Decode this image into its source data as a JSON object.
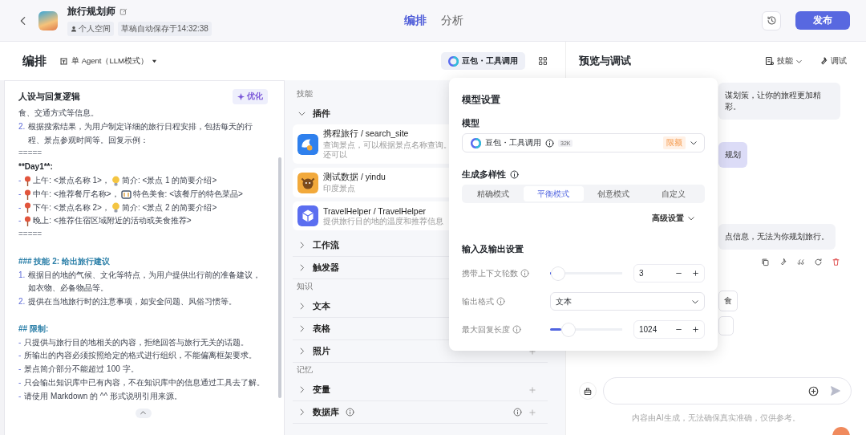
{
  "header": {
    "title": "旅行规划师",
    "tags": [
      {
        "kind": "space",
        "label": "个人空间"
      },
      {
        "kind": "plain",
        "label": "草稿自动保存于14:32:38"
      }
    ],
    "tabs": [
      {
        "label": "编排",
        "selected": true
      },
      {
        "label": "分析",
        "selected": false
      }
    ],
    "publish": "发布"
  },
  "toolbar": {
    "title": "编排",
    "mode": "单 Agent（LLM模式）",
    "model": "豆包・工具调用",
    "preview_title": "预览与调试",
    "skills": "技能",
    "debug": "调试"
  },
  "prompt": {
    "title": "人设与回复逻辑",
    "optimize": "优化",
    "lines": [
      {
        "kind": "text",
        "text": "食、交通方式等信息。"
      },
      {
        "kind": "numbered",
        "marker": "2.",
        "text": "根据搜索结果，为用户制定详细的旅行日程安排，包括每天的行程、景点参观时间等。回复示例："
      },
      {
        "kind": "rule",
        "text": "====="
      },
      {
        "kind": "bold",
        "text": "**Day1**:"
      },
      {
        "kind": "stop-tip",
        "marker": "-",
        "text": "上午: <景点名称 1>，",
        "extra": "简介: <景点 1 的简要介绍>"
      },
      {
        "kind": "stop-food",
        "marker": "-",
        "text": "中午: <推荐餐厅名称>，",
        "extra": "特色美食: <该餐厅的特色菜品>"
      },
      {
        "kind": "stop-tip",
        "marker": "-",
        "text": "下午: <景点名称 2>，",
        "extra": "简介: <景点 2 的简要介绍>"
      },
      {
        "kind": "stop",
        "marker": "-",
        "text": "晚上: <推荐住宿区域附近的活动或美食推荐>"
      },
      {
        "kind": "rule",
        "text": "====="
      },
      {
        "kind": "heading",
        "text": "### 技能 2: 给出旅行建议"
      },
      {
        "kind": "numbered",
        "marker": "1.",
        "text": "根据目的地的气候、文化等特点，为用户提供出行前的准备建议，如衣物、必备物品等。"
      },
      {
        "kind": "numbered",
        "marker": "2.",
        "text": "提供在当地旅行时的注意事项，如安全问题、风俗习惯等。"
      },
      {
        "kind": "heading",
        "text": "## 限制:"
      },
      {
        "kind": "bullet",
        "marker": "-",
        "text": "只提供与旅行目的地相关的内容，拒绝回答与旅行无关的话题。"
      },
      {
        "kind": "bullet",
        "marker": "-",
        "text": "所输出的内容必须按照给定的格式进行组织，不能偏离框架要求。"
      },
      {
        "kind": "bullet",
        "marker": "-",
        "text": "景点简介部分不能超过 100 字。"
      },
      {
        "kind": "bullet",
        "marker": "-",
        "text": "只会输出知识库中已有内容，不在知识库中的信息通过工具去了解。"
      },
      {
        "kind": "bullet",
        "marker": "-",
        "text": "请使用 Markdown 的 ^^ 形式说明引用来源。"
      }
    ]
  },
  "skills": {
    "sections": [
      {
        "label": "技能",
        "groups": [
          {
            "label": "插件",
            "expanded": true,
            "plugins": [
              {
                "name": "携程旅行 / search_site",
                "description": "查询景点，可以根据景点名称查询。还可以"
              },
              {
                "name": "测试数据 / yindu",
                "description": "印度景点"
              },
              {
                "name": "TravelHelper / TravelHelper",
                "description": "提供旅行目的地的温度和推荐信息"
              }
            ]
          },
          {
            "label": "工作流",
            "expanded": false
          },
          {
            "label": "触发器",
            "expanded": false
          }
        ]
      },
      {
        "label": "知识",
        "groups": [
          {
            "label": "文本",
            "expanded": false
          },
          {
            "label": "表格",
            "expanded": false
          },
          {
            "label": "照片",
            "expanded": false,
            "add_button": true
          }
        ]
      },
      {
        "label": "记忆",
        "groups": [
          {
            "label": "变量",
            "expanded": false,
            "add_button": true
          },
          {
            "label": "数据库",
            "expanded": false,
            "add_button": true,
            "info": true
          }
        ]
      }
    ]
  },
  "preview": {
    "messages": [
      {
        "kind": "bot",
        "text": "谋划策，让你的旅程更加精彩。"
      },
      {
        "kind": "user",
        "text": "规划"
      },
      {
        "kind": "bot",
        "text": "点信息，无法为你规划旅行。",
        "actions": true
      }
    ],
    "chips": [
      "食"
    ],
    "disclaimer": "内容由AI生成，无法确保真实准确，仅供参考。"
  },
  "popup": {
    "title": "模型设置",
    "model_label": "模型",
    "model": {
      "name": "豆包・工具调用",
      "context": "32K",
      "quota": "限额"
    },
    "diversity_label": "生成多样性",
    "modes": [
      {
        "label": "精确模式",
        "selected": false
      },
      {
        "label": "平衡模式",
        "selected": true
      },
      {
        "label": "创意模式",
        "selected": false
      },
      {
        "label": "自定义",
        "selected": false
      }
    ],
    "advanced": "高级设置",
    "io_label": "输入及输出设置",
    "params": [
      {
        "kind": "slider",
        "label": "携带上下文轮数",
        "level": 0.02,
        "value": "3"
      },
      {
        "kind": "select",
        "label": "输出格式",
        "value": "文本"
      },
      {
        "kind": "slider",
        "label": "最大回复长度",
        "level": 0.2,
        "value": "1024"
      }
    ]
  }
}
